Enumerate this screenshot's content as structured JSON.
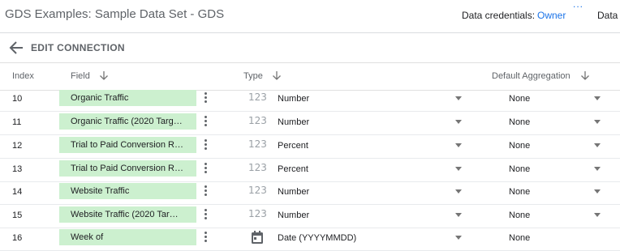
{
  "app": {
    "title": "GDS Examples: Sample Data Set - GDS",
    "dots": "...",
    "credentials_label": "Data credentials:",
    "credentials_value": "Owner",
    "data_tab": "Data"
  },
  "edit": {
    "title": "EDIT CONNECTION"
  },
  "columns": {
    "index": "Index",
    "field": "Field",
    "type": "Type",
    "aggregation": "Default Aggregation"
  },
  "icons": {
    "number": "123"
  },
  "rows": [
    {
      "index": "10",
      "field": "Organic Traffic",
      "type": "Number",
      "aggregation": "None",
      "type_icon": "number-icon"
    },
    {
      "index": "11",
      "field": "Organic Traffic (2020 Targ…",
      "type": "Number",
      "aggregation": "None",
      "type_icon": "number-icon"
    },
    {
      "index": "12",
      "field": "Trial to Paid Conversion R…",
      "type": "Percent",
      "aggregation": "None",
      "type_icon": "number-icon"
    },
    {
      "index": "13",
      "field": "Trial to Paid Conversion R…",
      "type": "Percent",
      "aggregation": "None",
      "type_icon": "number-icon"
    },
    {
      "index": "14",
      "field": "Website Traffic",
      "type": "Number",
      "aggregation": "None",
      "type_icon": "number-icon"
    },
    {
      "index": "15",
      "field": "Website Traffic (2020 Tar…",
      "type": "Number",
      "aggregation": "None",
      "type_icon": "number-icon"
    },
    {
      "index": "16",
      "field": "Week of",
      "type": "Date (YYYYMMDD)",
      "aggregation": "None",
      "type_icon": "calendar-icon"
    }
  ],
  "colors": {
    "chip": "#ccf0cf",
    "accent": "#1a73e8"
  }
}
